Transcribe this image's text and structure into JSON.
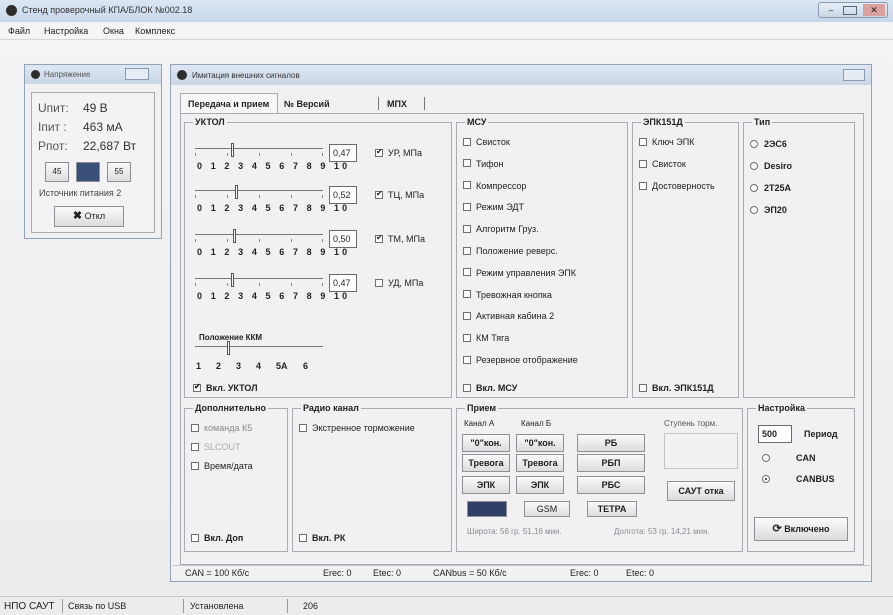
{
  "window": {
    "title": "Стенд проверочный КПА/БЛОК №002.18"
  },
  "menu": [
    "Файл",
    "Настройка",
    "Окна",
    "Комплекс"
  ],
  "voltage": {
    "title": "Напряжение",
    "u_label": "Uпит:",
    "u_value": "49 В",
    "i_label": "Iпит :",
    "i_value": "463 мА",
    "p_label": "Pпот:",
    "p_value": "22,687 Вт",
    "btn45": "45",
    "btn55": "55",
    "source": "Источник питания 2",
    "off": "Откл"
  },
  "signals": {
    "title": "Имитация внешних сигналов",
    "tabs": [
      "Передача и прием",
      "№ Версий",
      "МПХ"
    ]
  },
  "uktol": {
    "title": "УКТОЛ",
    "scale": "0 1 2 3 4 5 6 7 8 9 10",
    "sliders": [
      {
        "value": "0,47",
        "label": "УР, МПа",
        "checked": true,
        "level": 0.47
      },
      {
        "value": "0,52",
        "label": "ТЦ, МПа",
        "checked": true,
        "level": 0.52
      },
      {
        "value": "0,50",
        "label": "ТМ, МПа",
        "checked": true,
        "level": 0.5
      },
      {
        "value": "0,47",
        "label": "УД, МПа",
        "checked": false,
        "level": 0.47
      }
    ],
    "kkm_title": "Положение ККМ",
    "kkm_scale": [
      "1",
      "2",
      "3",
      "4",
      "5А",
      "6"
    ],
    "enable": "Вкл. УКТОЛ"
  },
  "msu": {
    "title": "МСУ",
    "items": [
      "Свисток",
      "Тифон",
      "Компрессор",
      "Режим ЭДТ",
      "Алгоритм Груз.",
      "Положение реверс.",
      "Режим управления ЭПК",
      "Тревожная кнопка",
      "Активная кабина 2",
      "КМ Тяга",
      "Резервное отображение"
    ],
    "enable": "Вкл. МСУ"
  },
  "epk": {
    "title": "ЭПК151Д",
    "items": [
      "Ключ ЭПК",
      "Свисток",
      "Достоверность"
    ],
    "enable": "Вкл. ЭПК151Д"
  },
  "type": {
    "title": "Тип",
    "items": [
      "2ЭС6",
      "Desiro",
      "2Т25А",
      "ЭП20"
    ]
  },
  "extra": {
    "title": "Дополнительно",
    "items": [
      "команда К5",
      "SLCOUT",
      "Время/дата"
    ],
    "enable": "Вкл. Доп"
  },
  "radio": {
    "title": "Радио канал",
    "item": "Экстренное торможение",
    "enable": "Вкл. РК"
  },
  "rx": {
    "title": "Прием",
    "channel_a": "Канал А",
    "channel_b": "Канал Б",
    "stages": "Ступень торм.",
    "zero": "\"0\"кон.",
    "alarm": "Тревога",
    "epk": "ЭПК",
    "rb": "РБ",
    "rbp": "РБП",
    "rbs": "РБС",
    "saut": "САУТ отка",
    "gsm": "GSM",
    "tetra": "ТЕТРА",
    "lat": "Широта: 56 гр. 51,16 мин.",
    "lon": "Долгота: 53 гр. 14,21 мин."
  },
  "settings": {
    "title": "Настройка",
    "period_value": "500",
    "period_label": "Период",
    "can": "CAN",
    "canbus": "CANBUS",
    "enabled": "Включено"
  },
  "inner_status": [
    "CAN = 100 Кб/с",
    "Erec: 0",
    "Etec: 0",
    "CANbus = 50 Кб/с",
    "Erec: 0",
    "Etec: 0"
  ],
  "status": [
    "НПО САУТ",
    "Связь по USB",
    "Установлена",
    "206"
  ]
}
